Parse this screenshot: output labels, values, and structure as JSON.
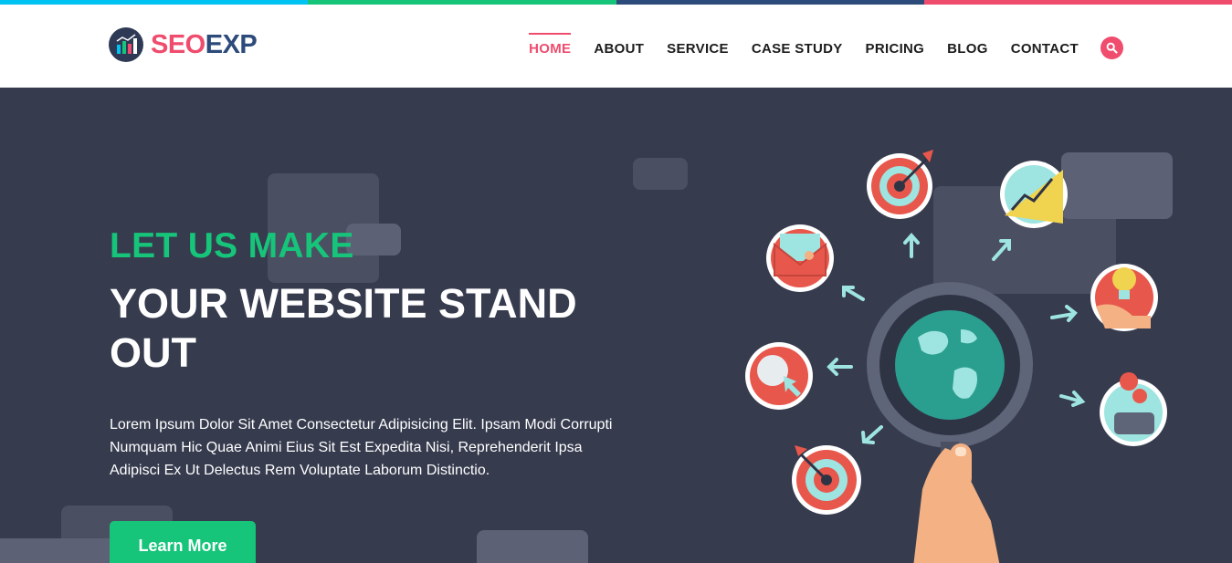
{
  "colors": {
    "strip": [
      "#00c2f3",
      "#16c47a",
      "#2c4a7a",
      "#ef4c6e"
    ],
    "accent_pink": "#ef4c6e",
    "accent_green": "#16c47a",
    "hero_bg": "#363b4e"
  },
  "brand": {
    "part1": "SEO",
    "part2": "EXP",
    "icon": "bar-chart-logo-icon"
  },
  "nav": {
    "items": [
      {
        "label": "HOME",
        "active": true
      },
      {
        "label": "ABOUT",
        "active": false
      },
      {
        "label": "SERVICE",
        "active": false
      },
      {
        "label": "CASE STUDY",
        "active": false
      },
      {
        "label": "PRICING",
        "active": false
      },
      {
        "label": "BLOG",
        "active": false
      },
      {
        "label": "CONTACT",
        "active": false
      }
    ],
    "search_icon": "search-icon"
  },
  "hero": {
    "eyebrow": "LET US MAKE",
    "headline": "YOUR WEBSITE STAND OUT",
    "body": "Lorem Ipsum Dolor Sit Amet Consectetur Adipisicing Elit. Ipsam Modi Corrupti Numquam Hic Quae Animi Eius Sit Est Expedita Nisi, Reprehenderit Ipsa Adipisci Ex Ut Delectus Rem Voluptate Laborum Distinctio.",
    "cta_label": "Learn More"
  }
}
